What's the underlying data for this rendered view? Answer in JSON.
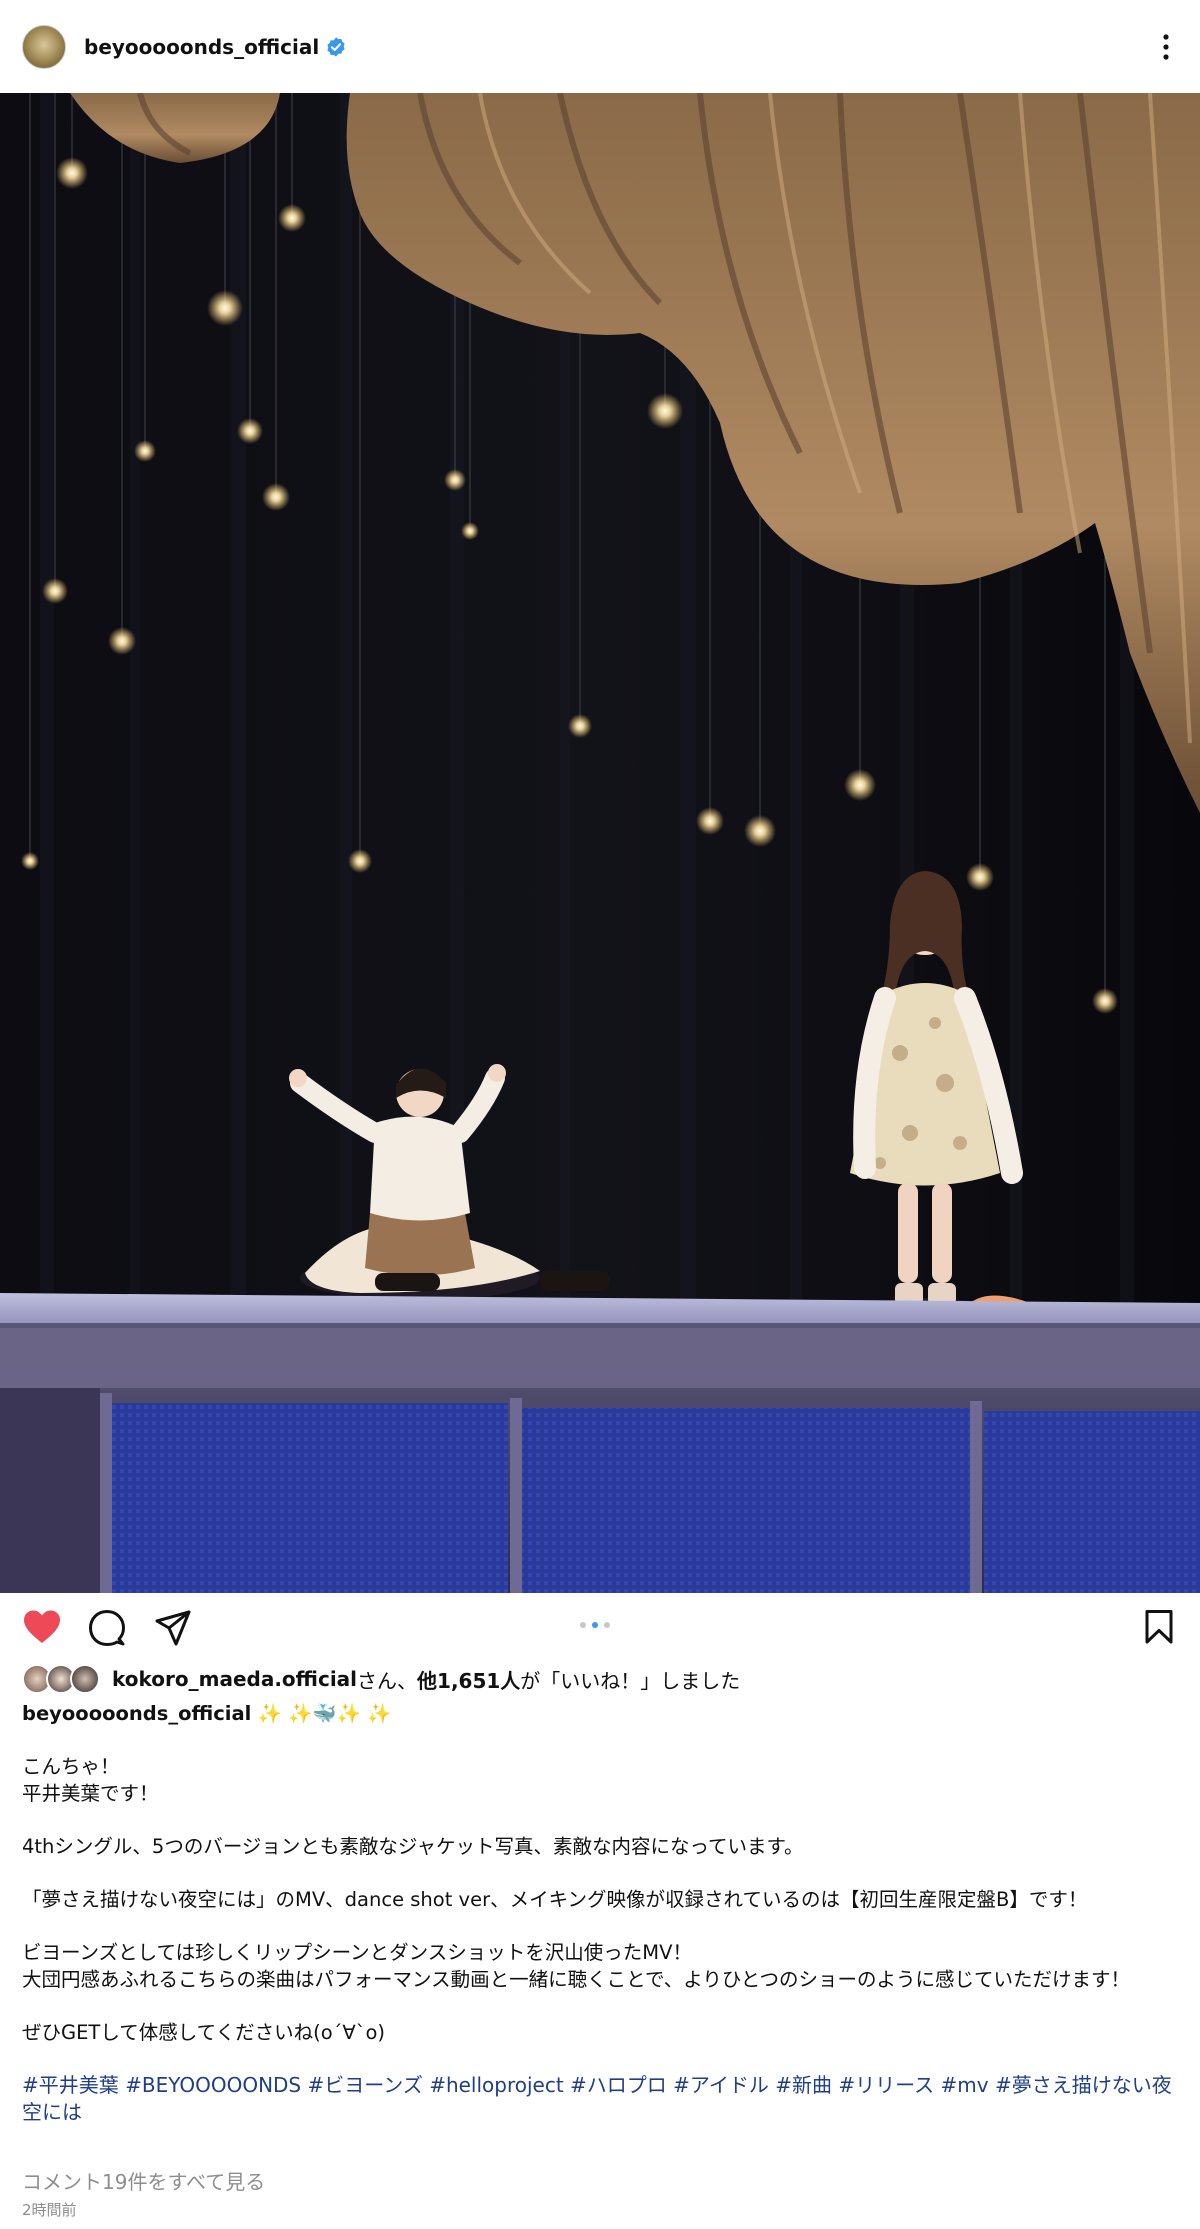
{
  "post": {
    "username": "beyooooonds_official",
    "verified": true,
    "more_icon": "more-vertical-icon",
    "image_alt": "",
    "carousel": {
      "count": 3,
      "active_index": 1
    },
    "likes": {
      "first_liker": "kokoro_maeda.official",
      "suffix_1": "さん、",
      "others_text": "他1,651人",
      "suffix_2": "が「いいね！」しました"
    },
    "caption": {
      "author": "beyooooonds_official",
      "emoji": "✨ ✨🐳✨ ✨",
      "paragraphs": [
        "こんちゃ！\n平井美葉です！",
        "4thシングル、5つのバージョンとも素敵なジャケット写真、素敵な内容になっています。",
        "「夢さえ描けない夜空には」のMV、dance shot ver、メイキング映像が収録されているのは【初回生産限定盤B】です！",
        "ビヨーンズとしては珍しくリップシーンとダンスショットを沢山使ったMV！\n大団円感あふれるこちらの楽曲はパフォーマンス動画と一緒に聴くことで、よりひとつのショーのように感じていただけます！",
        "ぜひGETして体感してくださいね(o´∀`o)"
      ],
      "hashtags": "#平井美葉 #BEYOOOOONDS #ビヨーンズ #helloproject #ハロプロ #アイドル #新曲 #リリース #mv #夢さえ描けない夜空には"
    },
    "view_comments": "コメント19件をすべて見る",
    "timestamp": "2時間前",
    "colors": {
      "like_red": "#ed4956",
      "verified_blue": "#3897f0",
      "hashtag": "#1f3f8a",
      "muted": "#8e8e8e"
    }
  }
}
